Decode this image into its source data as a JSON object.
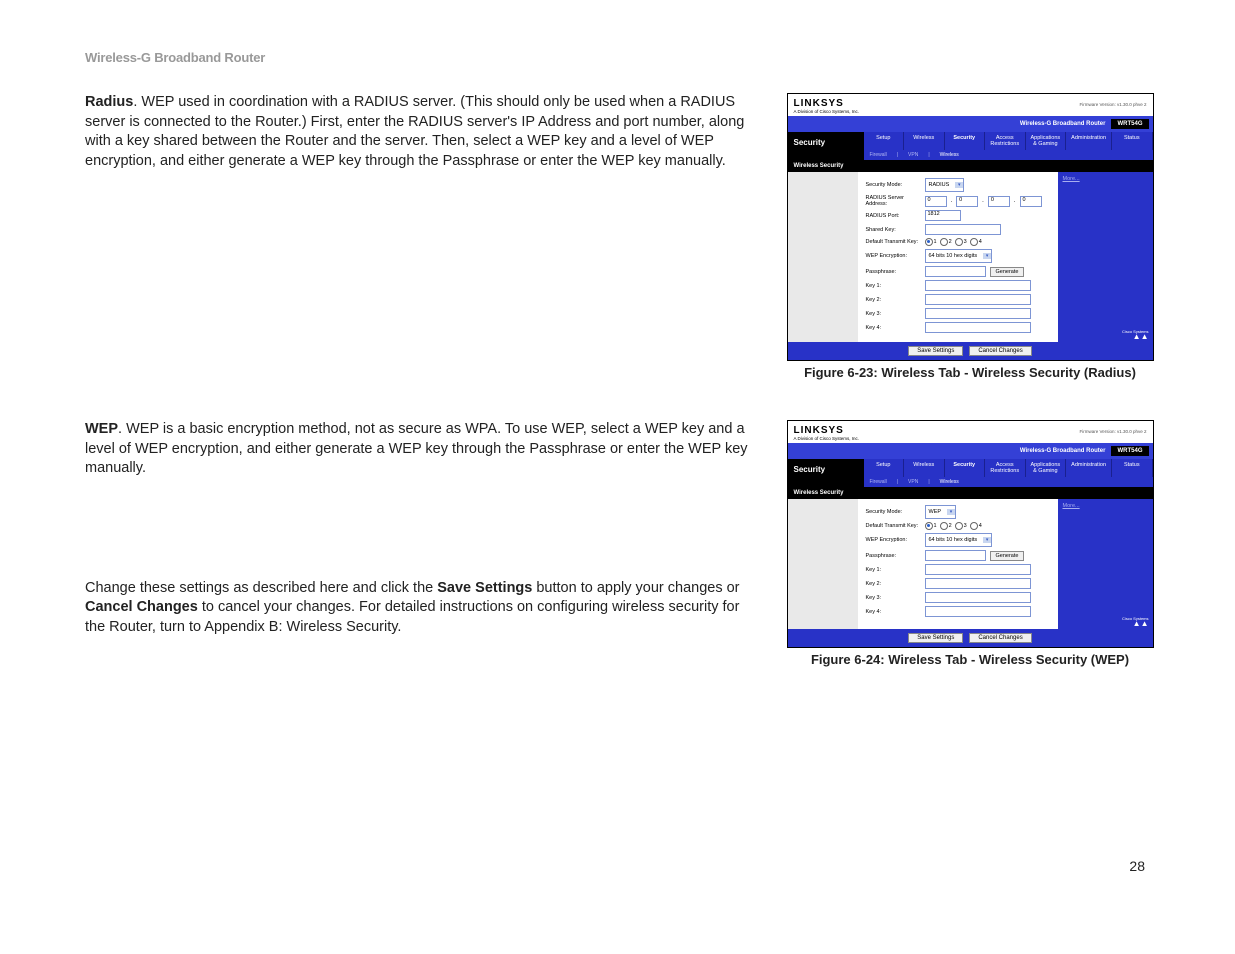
{
  "page": {
    "product": "Wireless-G Broadband Router",
    "number": "28"
  },
  "para": {
    "radius_head": "Radius",
    "radius_body": ". WEP used in coordination with a RADIUS server. (This should only be used when a RADIUS server is connected to the Router.) First, enter the RADIUS server's IP Address and port number, along with a key shared between the Router and the server. Then, select a WEP key and a level of WEP encryption, and either generate a WEP key through the Passphrase or enter the WEP key manually.",
    "wep_head": "WEP",
    "wep_body": ". WEP is a basic encryption method, not as secure as WPA. To use WEP, select a WEP key and a level of WEP encryption, and either generate a WEP key through the Passphrase or enter the WEP key manually.",
    "closing_1": "Change these settings as described here and click the ",
    "closing_save": "Save Settings",
    "closing_2": " button to apply your changes or ",
    "closing_cancel": "Cancel Changes",
    "closing_3": " to cancel your changes. For detailed instructions on configuring wireless security for the Router, turn to Appendix B: Wireless Security."
  },
  "fig23": {
    "caption": "Figure 6-23: Wireless Tab - Wireless Security (Radius)",
    "ui": {
      "logo": "LINKSYS",
      "sublogo": "A Division of Cisco Systems, Inc.",
      "firmware": "Firmware Version: v1.30.0 phve 2",
      "title_band": "Wireless-G Broadband Router",
      "model": "WRT54G",
      "section": "Security",
      "tabs": [
        "Setup",
        "Wireless",
        "Security",
        "Access Restrictions",
        "Applications & Gaming",
        "Administration",
        "Status"
      ],
      "subtabs": {
        "a": "Firewall",
        "b": "VPN",
        "c": "Wireless"
      },
      "left_label": "Wireless Security",
      "more": "More...",
      "fields": {
        "sec_mode_lbl": "Security Mode:",
        "sec_mode_val": "RADIUS",
        "radius_addr_lbl": "RADIUS Server Address:",
        "ip": [
          "0",
          "0",
          "0",
          "0"
        ],
        "radius_port_lbl": "RADIUS Port:",
        "radius_port_val": "1812",
        "shared_key_lbl": "Shared Key:",
        "def_key_lbl": "Default Transmit Key:",
        "radio_labels": [
          "1",
          "2",
          "3",
          "4"
        ],
        "radio_selected": 0,
        "wep_enc_lbl": "WEP Encryption:",
        "wep_enc_val": "64 bits 10 hex digits",
        "pass_lbl": "Passphrase:",
        "generate_btn": "Generate",
        "k1": "Key 1:",
        "k2": "Key 2:",
        "k3": "Key 3:",
        "k4": "Key 4:"
      },
      "save": "Save Settings",
      "cancel": "Cancel Changes",
      "corner_txt": "Cisco Systems"
    }
  },
  "fig24": {
    "caption": "Figure 6-24: Wireless Tab - Wireless Security (WEP)",
    "ui": {
      "logo": "LINKSYS",
      "sublogo": "A Division of Cisco Systems, Inc.",
      "firmware": "Firmware Version: v1.30.0 phve 2",
      "title_band": "Wireless-G Broadband Router",
      "model": "WRT54G",
      "section": "Security",
      "tabs": [
        "Setup",
        "Wireless",
        "Security",
        "Access Restrictions",
        "Applications & Gaming",
        "Administration",
        "Status"
      ],
      "subtabs": {
        "a": "Firewall",
        "b": "VPN",
        "c": "Wireless"
      },
      "left_label": "Wireless Security",
      "more": "More...",
      "fields": {
        "sec_mode_lbl": "Security Mode:",
        "sec_mode_val": "WEP",
        "def_key_lbl": "Default Transmit Key:",
        "radio_labels": [
          "1",
          "2",
          "3",
          "4"
        ],
        "radio_selected": 0,
        "wep_enc_lbl": "WEP Encryption:",
        "wep_enc_val": "64 bits 10 hex digits",
        "pass_lbl": "Passphrase:",
        "generate_btn": "Generate",
        "k1": "Key 1:",
        "k2": "Key 2:",
        "k3": "Key 3:",
        "k4": "Key 4:"
      },
      "save": "Save Settings",
      "cancel": "Cancel Changes",
      "corner_txt": "Cisco Systems"
    }
  }
}
